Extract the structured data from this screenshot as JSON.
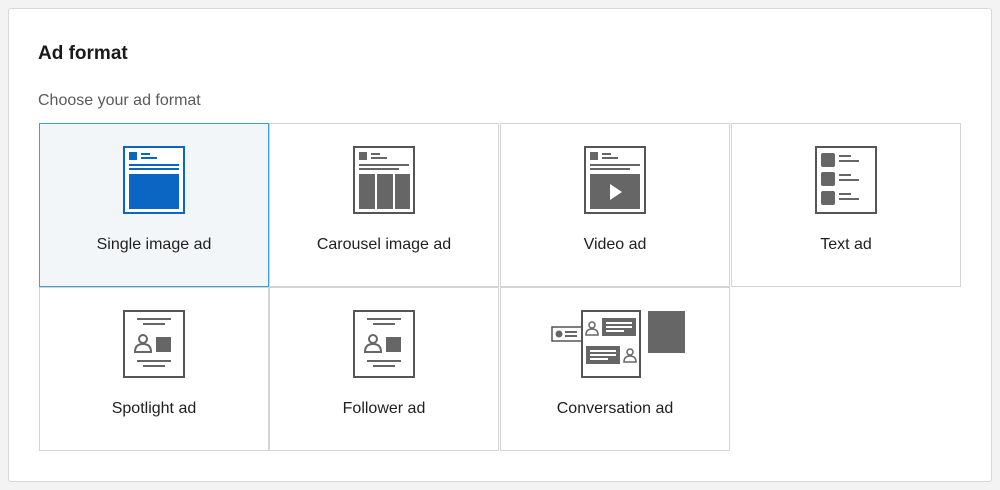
{
  "header": {
    "title": "Ad format",
    "subtitle": "Choose your ad format"
  },
  "colors": {
    "accent": "#0a66c2",
    "selected_border": "#3f9fd0",
    "selected_bg": "#f3f6f8",
    "icon_gray": "#666666"
  },
  "formats": [
    {
      "label": "Single image ad",
      "icon": "single-image-icon",
      "selected": true
    },
    {
      "label": "Carousel image ad",
      "icon": "carousel-image-icon",
      "selected": false
    },
    {
      "label": "Video ad",
      "icon": "video-icon",
      "selected": false
    },
    {
      "label": "Text ad",
      "icon": "text-ad-icon",
      "selected": false
    },
    {
      "label": "Spotlight ad",
      "icon": "spotlight-icon",
      "selected": false
    },
    {
      "label": "Follower ad",
      "icon": "follower-icon",
      "selected": false
    },
    {
      "label": "Conversation ad",
      "icon": "conversation-icon",
      "selected": false
    }
  ]
}
